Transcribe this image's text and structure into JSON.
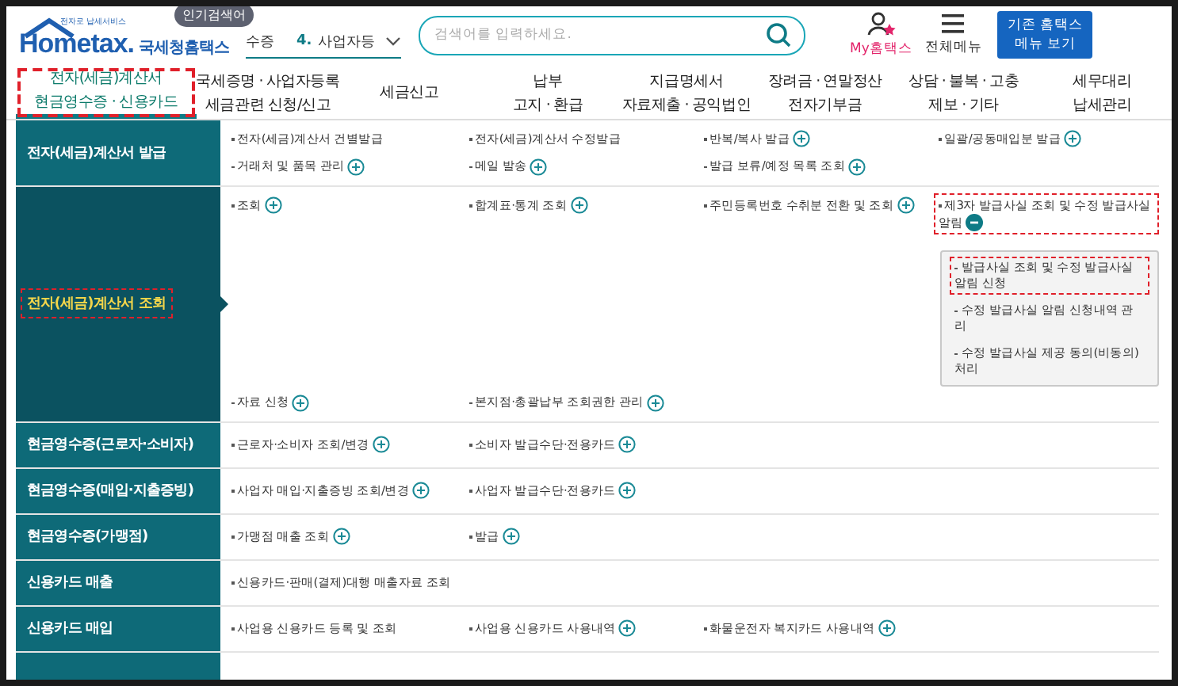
{
  "header": {
    "logo_tagline": "전자로 납세서비스",
    "logo_text": "Hometax.",
    "logo_name": "국세청홈택스",
    "popular_badge": "인기검색어",
    "ticker_prev": "수증",
    "ticker_number": "4.",
    "ticker_current": "사업자등",
    "search": {
      "placeholder": "검색어를 입력하세요."
    },
    "my_hometax": "My홈택스",
    "all_menu": "전체메뉴",
    "legacy_button": "기존 홈택스\n메뉴 보기"
  },
  "nav_tabs": [
    {
      "label": "전자(세금)계산서\n현금영수증 · 신용카드",
      "selected": true,
      "highlighted": true
    },
    {
      "label": "국세증명 · 사업자등록\n세금관련 신청/신고",
      "selected": false,
      "highlighted": false
    },
    {
      "label": "세금신고",
      "selected": false,
      "highlighted": false
    },
    {
      "label": "납부\n고지 · 환급",
      "selected": false,
      "highlighted": false
    },
    {
      "label": "지급명세서\n자료제출 · 공익법인",
      "selected": false,
      "highlighted": false
    },
    {
      "label": "장려금 · 연말정산\n전자기부금",
      "selected": false,
      "highlighted": false
    },
    {
      "label": "상담 · 불복 · 고충\n제보 · 기타",
      "selected": false,
      "highlighted": false
    },
    {
      "label": "세무대리\n납세관리",
      "selected": false,
      "highlighted": false
    }
  ],
  "menu_rows": [
    {
      "category": "전자(세금)계산서 발급",
      "selected": false,
      "highlighted": false,
      "items": [
        {
          "label": "전자(세금)계산서 건별발급",
          "kind": "link",
          "highlighted": false
        },
        {
          "label": "전자(세금)계산서 수정발급",
          "kind": "link",
          "highlighted": false
        },
        {
          "label": "반복/복사 발급",
          "kind": "more",
          "highlighted": false
        },
        {
          "label": "일괄/공동매입분 발급",
          "kind": "more",
          "highlighted": false
        },
        {
          "label": "거래처 및 품목 관리",
          "kind": "more",
          "highlighted": false
        },
        {
          "label": "메일 발송",
          "kind": "more",
          "highlighted": false
        },
        {
          "label": "발급 보류/예정 목록 조회",
          "kind": "more",
          "highlighted": false
        }
      ]
    },
    {
      "category": "전자(세금)계산서 조회",
      "selected": true,
      "highlighted": true,
      "items": [
        {
          "label": "조회",
          "kind": "more",
          "highlighted": false
        },
        {
          "label": "합계표·통계 조회",
          "kind": "more",
          "highlighted": false
        },
        {
          "label": "주민등록번호 수취분 전환 및 조회",
          "kind": "more",
          "highlighted": false
        },
        {
          "label": "제3자 발급사실 조회 및 수정 발급사실 알림",
          "kind": "open",
          "highlighted": true,
          "children": [
            {
              "label": "발급사실 조회 및 수정 발급사실 알림 신청",
              "highlighted": true
            },
            {
              "label": "수정 발급사실 알림 신청내역 관리",
              "highlighted": false
            },
            {
              "label": "수정 발급사실 제공 동의(비동의) 처리",
              "highlighted": false
            }
          ]
        },
        {
          "label": "자료 신청",
          "kind": "more",
          "highlighted": false
        },
        {
          "label": "본지점·총괄납부 조회권한 관리",
          "kind": "more",
          "highlighted": false
        }
      ]
    },
    {
      "category": "현금영수증(근로자·소비자)",
      "selected": false,
      "highlighted": false,
      "items": [
        {
          "label": "근로자·소비자 조회/변경",
          "kind": "more",
          "highlighted": false
        },
        {
          "label": "소비자 발급수단·전용카드",
          "kind": "more",
          "highlighted": false
        }
      ]
    },
    {
      "category": "현금영수증(매입·지출증빙)",
      "selected": false,
      "highlighted": false,
      "items": [
        {
          "label": "사업자 매입·지출증빙 조회/변경",
          "kind": "more",
          "highlighted": false
        },
        {
          "label": "사업자 발급수단·전용카드",
          "kind": "more",
          "highlighted": false
        }
      ]
    },
    {
      "category": "현금영수증(가맹점)",
      "selected": false,
      "highlighted": false,
      "items": [
        {
          "label": "가맹점 매출 조회",
          "kind": "more",
          "highlighted": false
        },
        {
          "label": "발급",
          "kind": "more",
          "highlighted": false
        }
      ]
    },
    {
      "category": "신용카드 매출",
      "selected": false,
      "highlighted": false,
      "items": [
        {
          "label": "신용카드·판매(결제)대행 매출자료 조회",
          "kind": "link",
          "highlighted": false
        }
      ]
    },
    {
      "category": "신용카드 매입",
      "selected": false,
      "highlighted": false,
      "items": [
        {
          "label": "사업용 신용카드 등록 및 조회",
          "kind": "link",
          "highlighted": false
        },
        {
          "label": "사업용 신용카드 사용내역",
          "kind": "more",
          "highlighted": false
        },
        {
          "label": "화물운전자 복지카드 사용내역",
          "kind": "more",
          "highlighted": false
        }
      ]
    }
  ]
}
